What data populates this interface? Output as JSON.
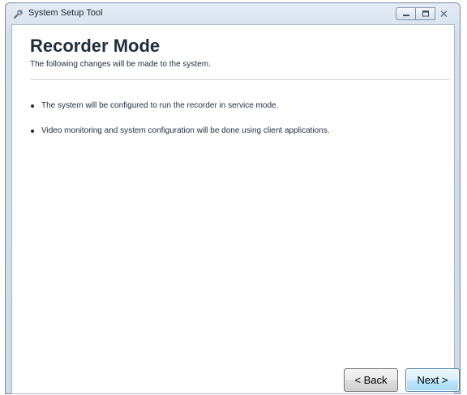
{
  "window": {
    "title": "System Setup Tool"
  },
  "page": {
    "title": "Recorder Mode",
    "subtitle": "The following changes will be made to the system."
  },
  "changes": [
    "The system will be configured to run the recorder in service mode.",
    "Video monitoring and system configuration will be done using client applications."
  ],
  "buttons": {
    "back_label": "< Back",
    "next_label": "Next >"
  },
  "icons": {
    "app": "setup-tool-icon",
    "minimize": "minimize-icon",
    "maximize": "maximize-icon",
    "close": "close-icon"
  }
}
